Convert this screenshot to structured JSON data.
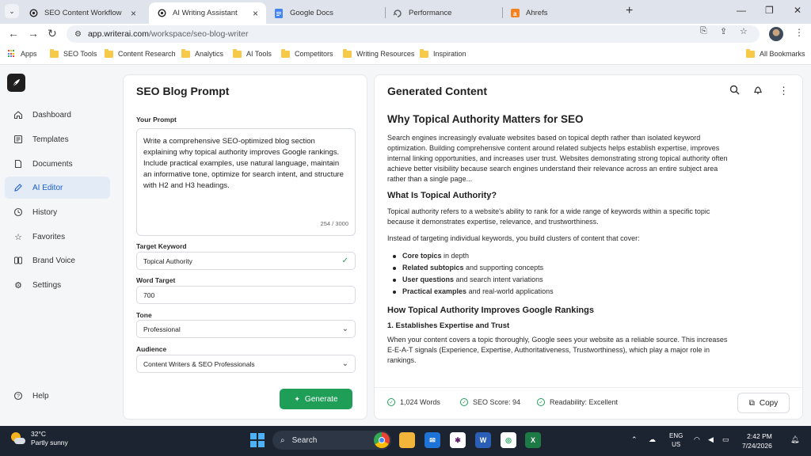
{
  "browser": {
    "tabs": [
      {
        "title": "SEO Content Workflow",
        "active": false
      },
      {
        "title": "AI Writing Assistant",
        "active": true
      },
      {
        "title": "Google Docs",
        "active": false
      },
      {
        "title": "Performance",
        "active": false
      },
      {
        "title": "Ahrefs",
        "active": false
      }
    ],
    "url_host": "app.writerai.com",
    "url_path": "/workspace/seo-blog-writer",
    "bookmarks": [
      "Apps",
      "SEO Tools",
      "Content Research",
      "Analytics",
      "AI Tools",
      "Competitors",
      "Writing Resources",
      "Inspiration"
    ],
    "all_bookmarks": "All Bookmarks"
  },
  "sidebar": {
    "items": [
      {
        "label": "Dashboard",
        "icon": "home-icon"
      },
      {
        "label": "Templates",
        "icon": "template-icon"
      },
      {
        "label": "Documents",
        "icon": "document-icon"
      },
      {
        "label": "AI Editor",
        "icon": "pen-icon",
        "active": true
      },
      {
        "label": "History",
        "icon": "history-icon"
      },
      {
        "label": "Favorites",
        "icon": "star-icon"
      },
      {
        "label": "Brand Voice",
        "icon": "brand-voice-icon"
      },
      {
        "label": "Settings",
        "icon": "gear-icon"
      }
    ],
    "help": "Help"
  },
  "prompt_panel": {
    "title": "SEO Blog Prompt",
    "prompt_label": "Your Prompt",
    "prompt_text": "Write a comprehensive SEO-optimized blog section explaining why topical authority improves Google rankings. Include practical examples, use natural language, maintain an informative tone, optimize for search intent, and structure with H2 and H3 headings.",
    "char_count": "254 / 3000",
    "keyword_label": "Target Keyword",
    "keyword_value": "Topical Authority",
    "word_target_label": "Word Target",
    "word_target_value": "700",
    "tone_label": "Tone",
    "tone_value": "Professional",
    "audience_label": "Audience",
    "audience_value": "Content Writers & SEO Professionals",
    "generate_label": "Generate"
  },
  "content_panel": {
    "title": "Generated Content",
    "h1": "Why Topical Authority Matters for SEO",
    "p1": "Search engines increasingly evaluate websites based on topical depth rather than isolated keyword optimization. Building comprehensive content around related subjects helps establish expertise, improves internal linking opportunities, and increases user trust. Websites demonstrating strong topical authority often achieve better visibility because search engines understand their relevance across an entire subject area rather than a single page...",
    "h2a": "What Is Topical Authority?",
    "p2": "Topical authority refers to a website's ability to rank for a wide range of keywords within a specific topic because it demonstrates expertise, relevance, and trustworthiness.",
    "p3": "Instead of targeting individual keywords, you build clusters of content that cover:",
    "bullets": [
      {
        "bold": "Core topics",
        "rest": " in depth"
      },
      {
        "bold": "Related subtopics",
        "rest": " and supporting concepts"
      },
      {
        "bold": "User questions",
        "rest": " and search intent variations"
      },
      {
        "bold": "Practical examples",
        "rest": " and real-world applications"
      }
    ],
    "h2b": "How Topical Authority Improves Google Rankings",
    "h3": "1. Establishes Expertise and Trust",
    "p4": "When your content covers a topic thoroughly, Google sees your website as a reliable source. This increases E-E-A-T signals (Experience, Expertise, Authoritativeness, Trustworthiness), which play a major role in rankings.",
    "stats": {
      "words": "1,024 Words",
      "seo": "SEO Score: 94",
      "readability": "Readability: Excellent"
    },
    "copy_label": "Copy"
  },
  "taskbar": {
    "temp": "32°C",
    "weather": "Partly sunny",
    "search": "Search",
    "lang1": "ENG",
    "lang2": "US",
    "time": "2:42 PM",
    "date": "7/24/2026"
  },
  "colors": {
    "accent": "#1a5ec8",
    "success": "#1e9e57"
  }
}
